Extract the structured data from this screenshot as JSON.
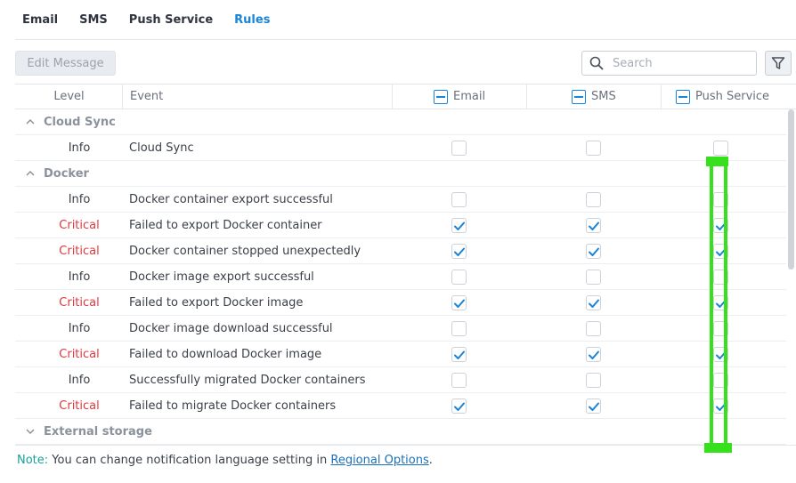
{
  "tabs": [
    {
      "label": "Email",
      "active": false
    },
    {
      "label": "SMS",
      "active": false
    },
    {
      "label": "Push Service",
      "active": false
    },
    {
      "label": "Rules",
      "active": true
    }
  ],
  "toolbar": {
    "edit_label": "Edit Message",
    "search_placeholder": "Search"
  },
  "columns": {
    "level": "Level",
    "event": "Event",
    "email": "Email",
    "sms": "SMS",
    "push": "Push Service"
  },
  "rows": [
    {
      "type": "group",
      "label": "Cloud Sync",
      "expanded": true
    },
    {
      "type": "item",
      "level": "Info",
      "event": "Cloud Sync",
      "email": false,
      "sms": false,
      "push": false
    },
    {
      "type": "group",
      "label": "Docker",
      "expanded": true
    },
    {
      "type": "item",
      "level": "Info",
      "event": "Docker container export successful",
      "email": false,
      "sms": false,
      "push": false
    },
    {
      "type": "item",
      "level": "Critical",
      "event": "Failed to export Docker container",
      "email": true,
      "sms": true,
      "push": true
    },
    {
      "type": "item",
      "level": "Critical",
      "event": "Docker container stopped unexpectedly",
      "email": true,
      "sms": true,
      "push": true
    },
    {
      "type": "item",
      "level": "Info",
      "event": "Docker image export successful",
      "email": false,
      "sms": false,
      "push": false
    },
    {
      "type": "item",
      "level": "Critical",
      "event": "Failed to export Docker image",
      "email": true,
      "sms": true,
      "push": true
    },
    {
      "type": "item",
      "level": "Info",
      "event": "Docker image download successful",
      "email": false,
      "sms": false,
      "push": false
    },
    {
      "type": "item",
      "level": "Critical",
      "event": "Failed to download Docker image",
      "email": true,
      "sms": true,
      "push": true
    },
    {
      "type": "item",
      "level": "Info",
      "event": "Successfully migrated Docker containers",
      "email": false,
      "sms": false,
      "push": false
    },
    {
      "type": "item",
      "level": "Critical",
      "event": "Failed to migrate Docker containers",
      "email": true,
      "sms": true,
      "push": true
    },
    {
      "type": "group",
      "label": "External storage",
      "expanded": false
    }
  ],
  "note": {
    "label": "Note:",
    "text": " You can change notification language setting in ",
    "link": "Regional Options",
    "end": "."
  },
  "colors": {
    "accent": "#1a84d8",
    "critical": "#e0383e",
    "highlight": "#36e01c"
  }
}
